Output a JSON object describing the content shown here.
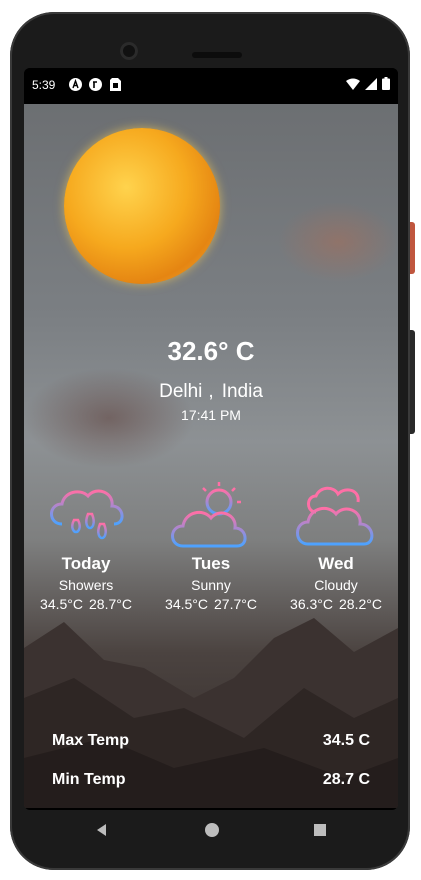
{
  "status_bar": {
    "time": "5:39",
    "left_icons": [
      "accessibility-icon",
      "app-notification-icon",
      "sim-card-icon"
    ],
    "right_icons": [
      "wifi-icon",
      "signal-icon",
      "battery-icon"
    ]
  },
  "weather": {
    "temperature": "32.6° C",
    "city": "Delhi",
    "separator": ",",
    "country": "India",
    "time": "17:41 PM"
  },
  "forecast": [
    {
      "day": "Today",
      "condition": "Showers",
      "max": "34.5°C",
      "min": "28.7°C",
      "icon": "rain-cloud-icon"
    },
    {
      "day": "Tues",
      "condition": "Sunny",
      "max": "34.5°C",
      "min": "27.7°C",
      "icon": "sun-cloud-icon"
    },
    {
      "day": "Wed",
      "condition": "Cloudy",
      "max": "36.3°C",
      "min": "28.2°C",
      "icon": "cloudy-icon"
    }
  ],
  "stats": {
    "max_label": "Max Temp",
    "max_value": "34.5 C",
    "min_label": "Min Temp",
    "min_value": "28.7 C"
  },
  "nav_bar": {
    "icons": [
      "back-icon",
      "home-icon",
      "recents-icon"
    ]
  },
  "colors": {
    "icon_gradient_start": "#ff6fa6",
    "icon_gradient_end": "#4da2ff",
    "sun_orange": "#f6a91e"
  }
}
